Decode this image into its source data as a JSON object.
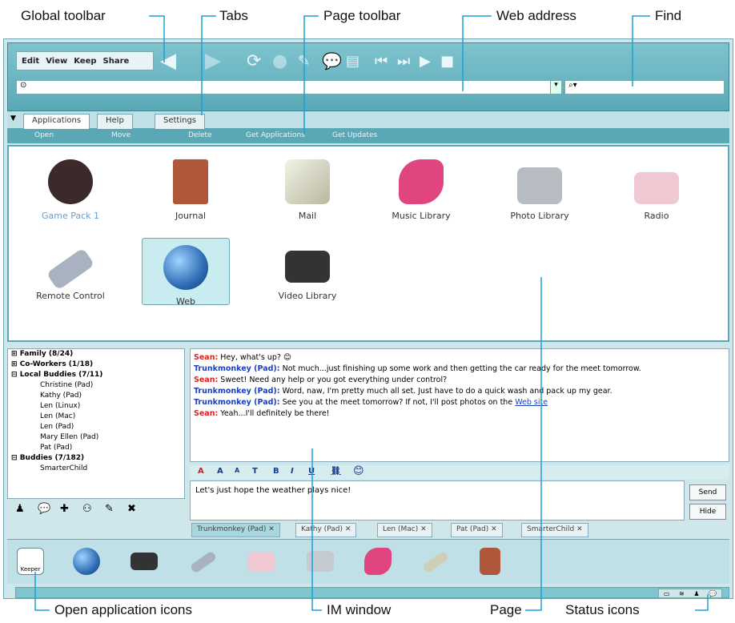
{
  "callouts": {
    "global_toolbar": "Global toolbar",
    "tabs": "Tabs",
    "page_toolbar": "Page toolbar",
    "web_address": "Web address",
    "find": "Find",
    "open_application_icons": "Open application icons",
    "im_window": "IM window",
    "page": "Page",
    "status_icons": "Status icons"
  },
  "toolbar": {
    "menus": [
      "Edit",
      "View",
      "Keep",
      "Share"
    ]
  },
  "tabs": [
    "Applications",
    "Help",
    "Settings"
  ],
  "page_toolbar": [
    "Open",
    "Move",
    "Delete",
    "Get Applications",
    "Get Updates"
  ],
  "apps": [
    {
      "label": "Game Pack 1",
      "icon": "game-pack-icon",
      "color": "#8fb0c9"
    },
    {
      "label": "Journal",
      "icon": "journal-icon",
      "color": "#b0563a"
    },
    {
      "label": "Mail",
      "icon": "mail-icon",
      "color": "#cfcfb8"
    },
    {
      "label": "Music Library",
      "icon": "guitar-icon",
      "color": "#e0457f"
    },
    {
      "label": "Photo Library",
      "icon": "camera-icon",
      "color": "#9aa2aa"
    },
    {
      "label": "Radio",
      "icon": "radio-icon",
      "color": "#f0c8d2"
    },
    {
      "label": "Remote Control",
      "icon": "remote-icon",
      "color": "#a8b2c0"
    },
    {
      "label": "Web",
      "icon": "globe-icon",
      "color": "#2f6db5"
    },
    {
      "label": "Video Library",
      "icon": "video-camera-icon",
      "color": "#333333"
    }
  ],
  "buddy_list": [
    {
      "text": "Family (8/24)",
      "group": true
    },
    {
      "text": "Co-Workers (1/18)",
      "group": true
    },
    {
      "text": "Local Buddies (7/11)",
      "group": true
    },
    {
      "text": "Christine (Pad)",
      "group": false
    },
    {
      "text": "Kathy (Pad)",
      "group": false
    },
    {
      "text": "Len (Linux)",
      "group": false
    },
    {
      "text": "Len (Mac)",
      "group": false
    },
    {
      "text": "Len (Pad)",
      "group": false
    },
    {
      "text": "Mary Ellen (Pad)",
      "group": false
    },
    {
      "text": "Pat (Pad)",
      "group": false
    },
    {
      "text": "Buddies (7/182)",
      "group": true
    },
    {
      "text": "SmarterChild",
      "group": false
    }
  ],
  "chat": [
    {
      "speaker": "Sean:",
      "color": "#d22",
      "text": " Hey, what's up?"
    },
    {
      "speaker": "Trunkmonkey (Pad):",
      "color": "#1a3ec2",
      "text": " Not much...just finishing up some work and then getting the car ready for the meet tomorrow."
    },
    {
      "speaker": "Sean:",
      "color": "#d22",
      "text": " Sweet! Need any help or you got everything under control?"
    },
    {
      "speaker": "Trunkmonkey (Pad):",
      "color": "#1a3ec2",
      "text": " Word, naw, I'm pretty much all set. Just have to do a quick wash and pack up my gear."
    },
    {
      "speaker": "Trunkmonkey (Pad):",
      "color": "#1a3ec2",
      "text": " See you at the meet tomorrow? If not, I'll post photos on the ",
      "link": "Web site"
    },
    {
      "speaker": "Sean:",
      "color": "#d22",
      "text": " Yeah...I'll definitely be there!"
    }
  ],
  "compose_text": "Let's just hope the weather plays nice!",
  "send_label": "Send",
  "hide_label": "Hide",
  "im_tabs": [
    "Trunkmonkey (Pad)",
    "Kathy (Pad)",
    "Len (Mac)",
    "Pat (Pad)",
    "SmarterChild"
  ],
  "keeper_label": "Keeper"
}
